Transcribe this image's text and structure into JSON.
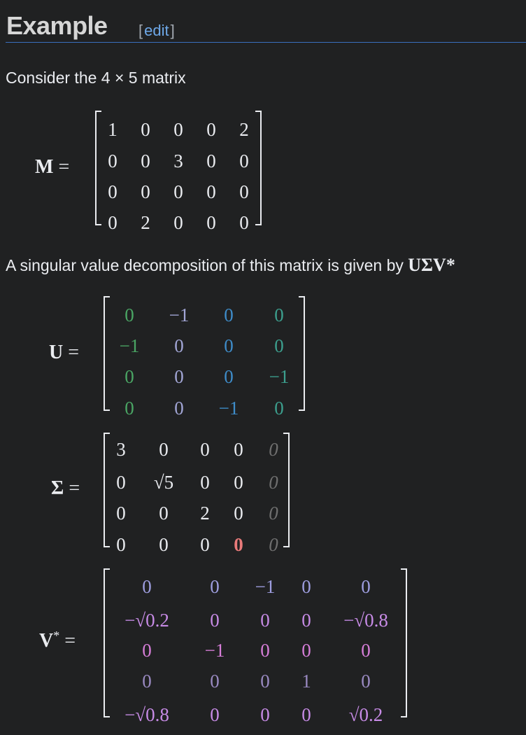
{
  "section": {
    "title": "Example",
    "edit_open": "[",
    "edit_label": "edit",
    "edit_close": "]"
  },
  "intro": {
    "text": "Consider the 4 × 5 matrix"
  },
  "decomp": {
    "text": "A singular value decomposition of this matrix is given by ",
    "symbol": "UΣV*"
  },
  "colors": {
    "text": "#eaecf0",
    "green": "#4aa564",
    "lavender": "#a2a6d6",
    "blue": "#3e8cc9",
    "teal": "#3c9f8e",
    "gray_italic": "#6f6f6f",
    "red": "#e87a7a",
    "purple_light": "#9e9ee0",
    "purple_mid": "#c78be6",
    "purple_dark": "#9a8ac2",
    "pink": "#d77ed9"
  },
  "matrices": [
    {
      "name": "M",
      "lhs_symbol": "M",
      "lhs_sup": "",
      "rows": [
        [
          "1",
          "0",
          "0",
          "0",
          "2"
        ],
        [
          "0",
          "0",
          "3",
          "0",
          "0"
        ],
        [
          "0",
          "0",
          "0",
          "0",
          "0"
        ],
        [
          "0",
          "2",
          "0",
          "0",
          "0"
        ]
      ],
      "colors": [
        [
          "text",
          "text",
          "text",
          "text",
          "text"
        ],
        [
          "text",
          "text",
          "text",
          "text",
          "text"
        ],
        [
          "text",
          "text",
          "text",
          "text",
          "text"
        ],
        [
          "text",
          "text",
          "text",
          "text",
          "text"
        ]
      ]
    },
    {
      "name": "U",
      "lhs_symbol": "U",
      "lhs_sup": "",
      "rows": [
        [
          "0",
          "−1",
          "0",
          "0"
        ],
        [
          "−1",
          "0",
          "0",
          "0"
        ],
        [
          "0",
          "0",
          "0",
          "−1"
        ],
        [
          "0",
          "0",
          "−1",
          "0"
        ]
      ],
      "colors": [
        [
          "green",
          "lavender",
          "blue",
          "teal"
        ],
        [
          "green",
          "lavender",
          "blue",
          "teal"
        ],
        [
          "green",
          "lavender",
          "blue",
          "teal"
        ],
        [
          "green",
          "lavender",
          "blue",
          "teal"
        ]
      ]
    },
    {
      "name": "Sigma",
      "lhs_symbol": "Σ",
      "lhs_sup": "",
      "rows": [
        [
          "3",
          "0",
          "0",
          "0",
          "0"
        ],
        [
          "0",
          "√5",
          "0",
          "0",
          "0"
        ],
        [
          "0",
          "0",
          "2",
          "0",
          "0"
        ],
        [
          "0",
          "0",
          "0",
          "0",
          "0"
        ]
      ],
      "colors": [
        [
          "text",
          "text",
          "text",
          "text",
          "gray_italic"
        ],
        [
          "text",
          "text",
          "text",
          "text",
          "gray_italic"
        ],
        [
          "text",
          "text",
          "text",
          "text",
          "gray_italic"
        ],
        [
          "text",
          "text",
          "text",
          "red",
          "gray_italic"
        ]
      ]
    },
    {
      "name": "V",
      "lhs_symbol": "V",
      "lhs_sup": "*",
      "rows": [
        [
          "0",
          "0",
          "−1",
          "0",
          "0"
        ],
        [
          "−√0.2",
          "0",
          "0",
          "0",
          "−√0.8"
        ],
        [
          "0",
          "−1",
          "0",
          "0",
          "0"
        ],
        [
          "0",
          "0",
          "0",
          "1",
          "0"
        ],
        [
          "−√0.8",
          "0",
          "0",
          "0",
          "√0.2"
        ]
      ],
      "colors": [
        [
          "purple_light",
          "purple_light",
          "purple_light",
          "purple_light",
          "purple_light"
        ],
        [
          "purple_mid",
          "purple_mid",
          "purple_mid",
          "purple_mid",
          "purple_mid"
        ],
        [
          "pink",
          "pink",
          "pink",
          "pink",
          "pink"
        ],
        [
          "purple_dark",
          "purple_dark",
          "purple_dark",
          "purple_dark",
          "purple_dark"
        ],
        [
          "purple_mid",
          "purple_mid",
          "purple_mid",
          "purple_mid",
          "purple_mid"
        ]
      ]
    }
  ]
}
